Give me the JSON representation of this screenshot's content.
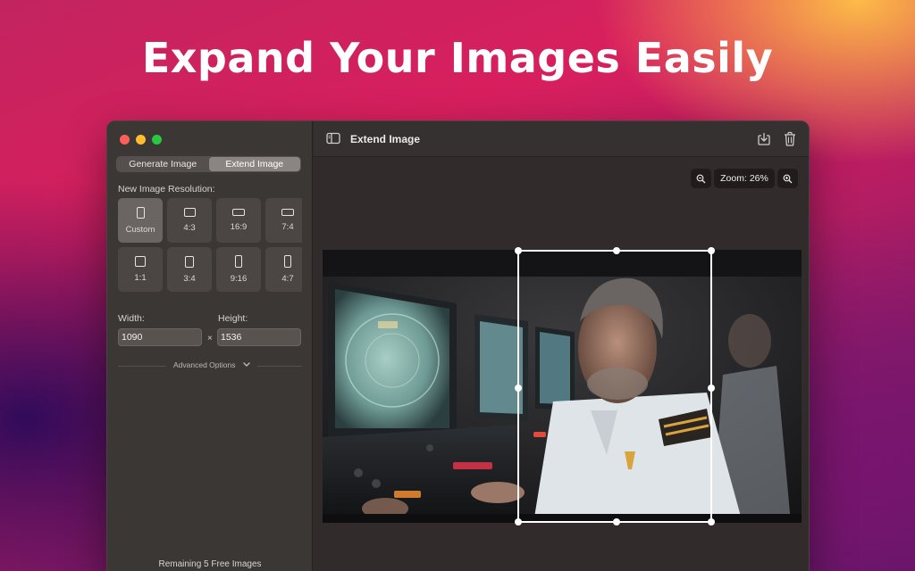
{
  "hero": {
    "title": "Expand Your Images Easily"
  },
  "sidebar": {
    "tabs": [
      {
        "label": "Generate Image",
        "active": false
      },
      {
        "label": "Extend Image",
        "active": true
      }
    ],
    "resolution_label": "New Image Resolution:",
    "ratios": [
      {
        "label": "Custom",
        "icon": "custom-ratio-icon",
        "selected": true
      },
      {
        "label": "4:3",
        "icon": "landscape-ratio-icon",
        "selected": false
      },
      {
        "label": "16:9",
        "icon": "wide-ratio-icon",
        "selected": false
      },
      {
        "label": "7:4",
        "icon": "wide-ratio-icon",
        "selected": false
      },
      {
        "label": "1:1",
        "icon": "square-ratio-icon",
        "selected": false
      },
      {
        "label": "3:4",
        "icon": "portrait-ratio-icon",
        "selected": false
      },
      {
        "label": "9:16",
        "icon": "tall-ratio-icon",
        "selected": false
      },
      {
        "label": "4:7",
        "icon": "tall-ratio-icon",
        "selected": false
      }
    ],
    "width_label": "Width:",
    "height_label": "Height:",
    "width_value": "1090",
    "height_value": "1536",
    "times_symbol": "×",
    "advanced_options_label": "Advanced Options",
    "remaining_text": "Remaining 5 Free Images"
  },
  "toolbar": {
    "title": "Extend Image",
    "icons": [
      "sidebar-toggle-icon",
      "export-icon",
      "trash-icon"
    ]
  },
  "zoom": {
    "label": "Zoom: 26%",
    "zoom_out_icon": "zoom-out-icon",
    "zoom_in_icon": "zoom-in-icon"
  },
  "colors": {
    "close": "#fe5f57",
    "minimize": "#febc2e",
    "maximize": "#28c840",
    "crop_border": "#ffffff"
  }
}
